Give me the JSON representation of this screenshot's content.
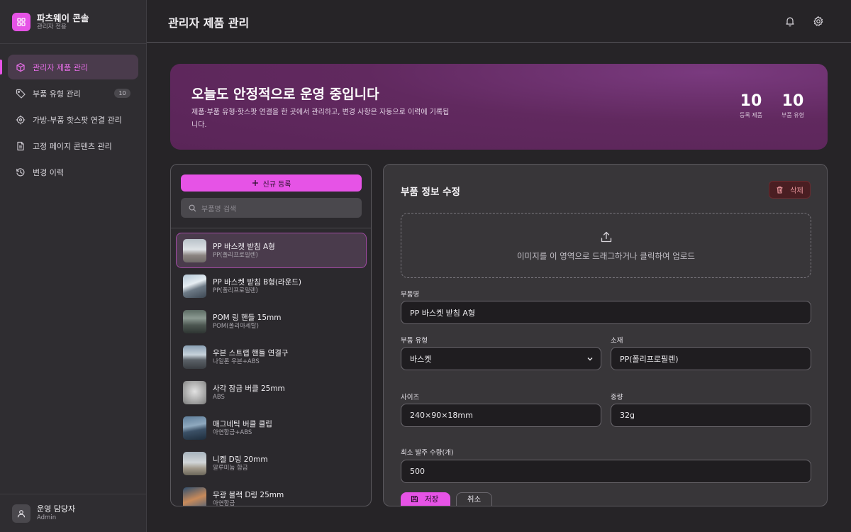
{
  "brand": {
    "title": "파츠웨이 콘솔",
    "subtitle": "관리자 전용"
  },
  "sidebar": {
    "items": [
      {
        "label": "관리자 제품 관리",
        "icon": "cube-icon",
        "active": true
      },
      {
        "label": "부품 유형 관리",
        "icon": "tag-icon",
        "badge": "10"
      },
      {
        "label": "가방-부품 핫스팟 연결 관리",
        "icon": "target-icon"
      },
      {
        "label": "고정 페이지 콘텐츠 관리",
        "icon": "document-icon"
      },
      {
        "label": "변경 이력",
        "icon": "history-icon"
      }
    ]
  },
  "user": {
    "name": "운영 담당자",
    "role": "Admin"
  },
  "header": {
    "title": "관리자 제품 관리",
    "icons": [
      "bell-icon",
      "gear-icon"
    ]
  },
  "hero": {
    "title": "오늘도 안정적으로 운영 중입니다",
    "description": "제품·부품 유형·핫스팟 연결을 한 곳에서 관리하고, 변경 사항은 자동으로 이력에 기록됩니다.",
    "stats": [
      {
        "value": "10",
        "label": "등록 제품"
      },
      {
        "value": "10",
        "label": "부품 유형"
      }
    ]
  },
  "list": {
    "new_button": "신규 등록",
    "search_placeholder": "부품명 검색",
    "items": [
      {
        "name": "PP 바스켓 받침 A형",
        "material": "PP(폴리프로필렌)",
        "selected": true
      },
      {
        "name": "PP 바스켓 받침 B형(라운드)",
        "material": "PP(폴리프로필렌)"
      },
      {
        "name": "POM 링 핸들 15mm",
        "material": "POM(폴리아세탈)"
      },
      {
        "name": "우븐 스트랩 핸들 연결구",
        "material": "나일론 우븐+ABS"
      },
      {
        "name": "사각 잠금 버클 25mm",
        "material": "ABS"
      },
      {
        "name": "매그네틱 버클 클립",
        "material": "아연합금+ABS"
      },
      {
        "name": "니켈 D링 20mm",
        "material": "알루미늄 합금"
      },
      {
        "name": "무광 블랙 D링 25mm",
        "material": "아연합금"
      }
    ]
  },
  "form": {
    "title": "부품 정보 수정",
    "delete_button": "삭제",
    "upload_text": "이미지를 이 영역으로 드래그하거나 클릭하여 업로드",
    "fields": {
      "name": {
        "label": "부품명",
        "value": "PP 바스켓 받침 A형"
      },
      "type": {
        "label": "부품 유형",
        "value": "바스켓"
      },
      "material": {
        "label": "소재",
        "value": "PP(폴리프로필렌)"
      },
      "size": {
        "label": "사이즈",
        "value": "240×90×18mm"
      },
      "weight": {
        "label": "중량",
        "value": "32g"
      },
      "moq": {
        "label": "최소 발주 수량(개)",
        "value": "500"
      }
    },
    "save_button": "저장",
    "cancel_button": "취소"
  },
  "colors": {
    "accent": "#e653e6",
    "hero": "#61295f",
    "danger": "#4a1e22"
  }
}
